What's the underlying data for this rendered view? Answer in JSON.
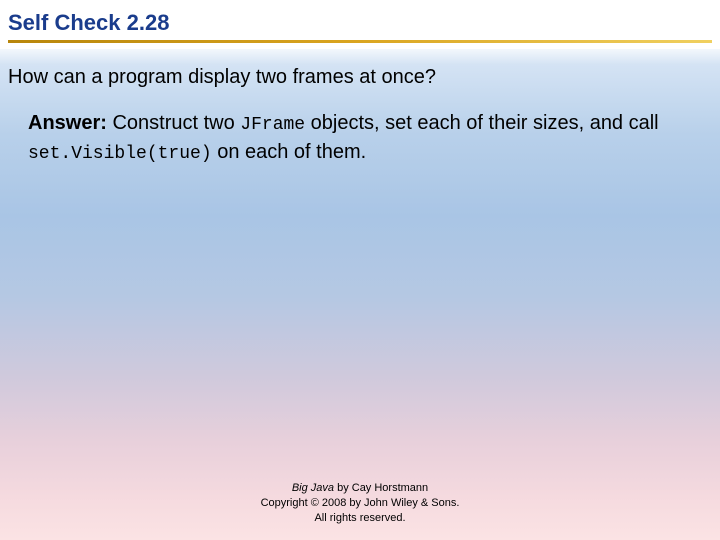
{
  "header": {
    "title": "Self Check 2.28"
  },
  "question": "How can a program display two frames at once?",
  "answer": {
    "label": "Answer:",
    "part1": " Construct two ",
    "code1": "JFrame",
    "part2": " objects, set each of their sizes, and call ",
    "code2": "set.Visible(true)",
    "part3": " on each of them."
  },
  "footer": {
    "booktitle": "Big Java",
    "author": " by Cay Horstmann",
    "copyright": "Copyright © 2008 by John Wiley & Sons.",
    "rights": "All rights reserved."
  }
}
